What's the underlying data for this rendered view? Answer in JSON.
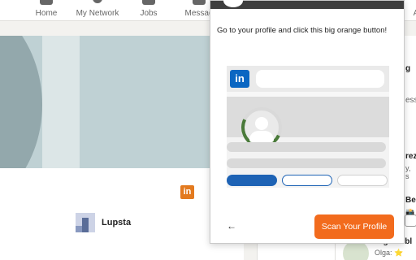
{
  "nav": {
    "home": "Home",
    "network": "My Network",
    "jobs": "Jobs",
    "messaging": "Messag",
    "partial_a": "A"
  },
  "profile": {
    "company_name": "Lupsta",
    "badge_label": "in"
  },
  "right_col": {
    "g": "g",
    "ess": "ess",
    "rez": "rez",
    "y": "y, s",
    "be": "Be",
    "o": "📸O",
    "olga": "Olga Lubl",
    "olga_sub": "Olga: ⭐"
  },
  "popup": {
    "instruction": "Go to your profile and click this big orange button!",
    "mock_logo": "in",
    "back_arrow": "←",
    "scan_button": "Scan Your Profile"
  },
  "colors": {
    "accent_orange": "#f26b1d",
    "linkedin_blue": "#0a66c2"
  }
}
